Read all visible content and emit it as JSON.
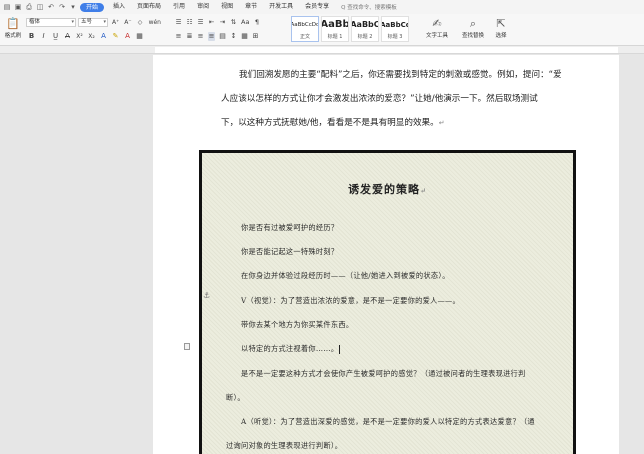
{
  "quick_access": [
    "doc-icon",
    "save-icon",
    "print-icon",
    "preview-icon",
    "undo-icon",
    "redo-icon",
    "more-icon"
  ],
  "menu_tabs": [
    "开始",
    "插入",
    "页面布局",
    "引用",
    "审阅",
    "视图",
    "章节",
    "开发工具",
    "会员专享"
  ],
  "active_tab_index": 0,
  "search": {
    "label": "Q 查找命令、搜索模板"
  },
  "ribbon": {
    "paste_label": "粘贴",
    "format_painter_label": "格式刷",
    "font_name": "楷体",
    "font_size": "五号",
    "format_row1": [
      "A⁺",
      "A⁻",
      "◇",
      "wén"
    ],
    "format_row2": [
      "B",
      "I",
      "U̲",
      "A",
      "X²",
      "X₂",
      "A",
      "✎",
      "A",
      "▦"
    ],
    "para_row1": [
      "☰",
      "☷",
      "☰",
      "⇤",
      "⇥",
      "⇅",
      "Aa",
      "¶"
    ],
    "para_row2": [
      "≡",
      "≣",
      "≡",
      "≡",
      "▤",
      "↕",
      "▦",
      "⊞"
    ],
    "styles": [
      {
        "sample": "AaBbCcDd",
        "name": "正文"
      },
      {
        "sample": "AaBb",
        "name": "标题 1"
      },
      {
        "sample": "AaBbC",
        "name": "标题 2"
      },
      {
        "sample": "AaBbCc",
        "name": "标题 3"
      }
    ],
    "text_tool_label": "文字工具",
    "find_replace_label": "查找替换",
    "select_label": "选择",
    "accent_color": "#3f7ee8"
  },
  "document": {
    "paragraphs": [
      "我们回溯发愿的主要“配料”之后，你还需要找到特定的刺激或感觉。例如，提问：“爱",
      "人应该以怎样的方式让你才会激发出浓浓的爱恋？”让她/他演示一下。然后取场测试",
      "下，以这种方式抚慰她/他，看看是不是具有明显的效果。"
    ],
    "paragraph_mark": "↵",
    "figure": {
      "title": "诱发爱的策略",
      "lines": [
        "你是否有过被爱呵护的经历？",
        "你是否能记起这一特殊时刻？",
        "在你身边并体验过段经历时——（让他/她进入到被爱的状态）。",
        "V（视觉）：为了营造出浓浓的爱意，是不是一定要你的爱人——。",
        "带你去某个地方为你买某件东西。",
        "以特定的方式注视着你……。",
        "是不是一定要这种方式才会使你产生被爱呵护的感觉？（通过被问者的生理表现进行判",
        "断）。",
        "A（听觉）：为了营造出深爱的感觉，是不是一定要你的爱人以特定的方式表达爱意？（通",
        "过询问对象的生理表现进行判断）。"
      ]
    }
  }
}
